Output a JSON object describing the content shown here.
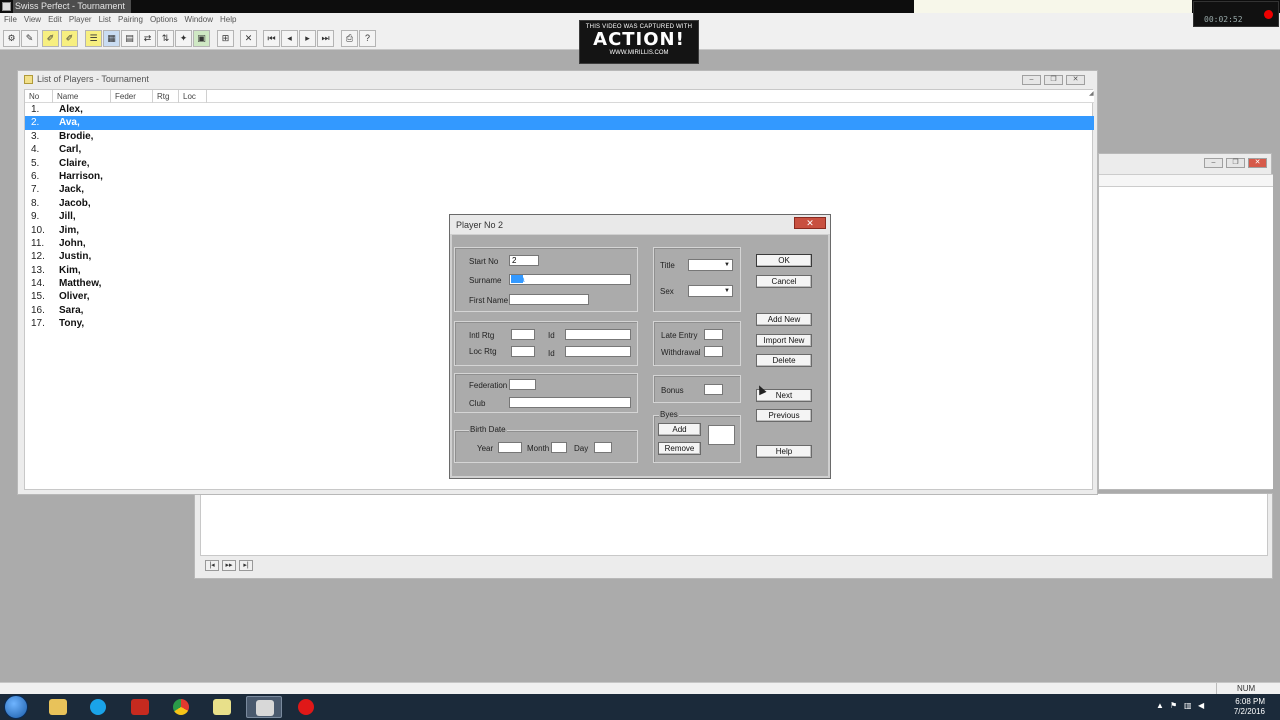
{
  "app": {
    "title": "Swiss Perfect - Tournament",
    "menu": [
      "File",
      "View",
      "Edit",
      "Player",
      "List",
      "Pairing",
      "Options",
      "Window",
      "Help"
    ]
  },
  "recorder": {
    "watermark_top": "THIS VIDEO WAS CAPTURED WITH",
    "watermark_logo": "ACTION!",
    "watermark_url": "WWW.MIRILLIS.COM",
    "time": "00:02:52"
  },
  "list_window": {
    "title": "List of Players - Tournament",
    "columns": [
      "No",
      "Name",
      "Feder",
      "Rtg",
      "Loc"
    ],
    "players": [
      {
        "no": "1.",
        "name": "Alex,"
      },
      {
        "no": "2.",
        "name": "Ava,"
      },
      {
        "no": "3.",
        "name": "Brodie,"
      },
      {
        "no": "4.",
        "name": "Carl,"
      },
      {
        "no": "5.",
        "name": "Claire,"
      },
      {
        "no": "6.",
        "name": "Harrison,"
      },
      {
        "no": "7.",
        "name": "Jack,"
      },
      {
        "no": "8.",
        "name": "Jacob,"
      },
      {
        "no": "9.",
        "name": "Jill,"
      },
      {
        "no": "10.",
        "name": "Jim,"
      },
      {
        "no": "11.",
        "name": "John,"
      },
      {
        "no": "12.",
        "name": "Justin,"
      },
      {
        "no": "13.",
        "name": "Kim,"
      },
      {
        "no": "14.",
        "name": "Matthew,"
      },
      {
        "no": "15.",
        "name": "Oliver,"
      },
      {
        "no": "16.",
        "name": "Sara,"
      },
      {
        "no": "17.",
        "name": "Tony,"
      }
    ],
    "selected_index": 1
  },
  "dialog": {
    "title": "Player No 2",
    "labels": {
      "start_no": "Start No",
      "surname": "Surname",
      "first_name": "First Name",
      "title": "Title",
      "sex": "Sex",
      "intl_rtg": "Intl Rtg",
      "loc_rtg": "Loc Rtg",
      "id": "Id",
      "late_entry": "Late Entry",
      "withdrawal": "Withdrawal",
      "federation": "Federation",
      "club": "Club",
      "bonus": "Bonus",
      "byes": "Byes",
      "birth_date": "Birth Date",
      "year": "Year",
      "month": "Month",
      "day": "Day"
    },
    "values": {
      "start_no": "2",
      "surname": "Ava"
    },
    "buttons": {
      "ok": "OK",
      "cancel": "Cancel",
      "add_new": "Add New",
      "import_new": "Import New",
      "delete": "Delete",
      "next": "Next",
      "previous": "Previous",
      "help": "Help",
      "byes_add": "Add",
      "byes_remove": "Remove"
    }
  },
  "status": {
    "num": "NUM"
  },
  "taskbar": {
    "time": "6:08 PM",
    "date": "7/2/2016"
  }
}
